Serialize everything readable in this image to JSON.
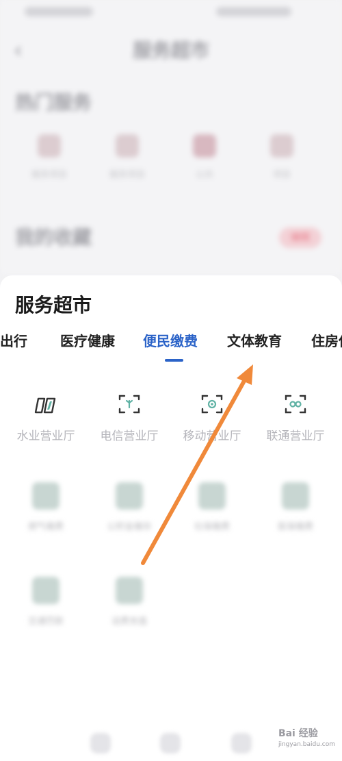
{
  "upper": {
    "title": "服务超市",
    "hot_heading": "热门服务",
    "hot_items": [
      "服务项目",
      "服务项目",
      "公共",
      "项目"
    ],
    "fav_heading": "我的收藏",
    "edit_label": "编辑"
  },
  "sheet": {
    "title": "服务超市",
    "tabs": [
      {
        "label": "交通出行"
      },
      {
        "label": "医疗健康"
      },
      {
        "label": "便民缴费"
      },
      {
        "label": "文体教育"
      },
      {
        "label": "住房保障"
      }
    ],
    "active_tab": 2,
    "service_items": [
      {
        "label": "水业营业厅",
        "icon": "water-bill-icon"
      },
      {
        "label": "电信营业厅",
        "icon": "telecom-icon"
      },
      {
        "label": "移动营业厅",
        "icon": "mobile-icon"
      },
      {
        "label": "联通营业厅",
        "icon": "unicom-icon"
      }
    ],
    "blurred_items": [
      "燃气缴费",
      "公积金缴存",
      "社保缴费",
      "医保缴费",
      "交通罚款",
      "话费充值"
    ]
  },
  "colors": {
    "accent": "#2b63c8",
    "icon_teal": "#5fb2a4",
    "arrow": "#f0893a",
    "edit_badge": "#f3d1d6"
  },
  "watermark": {
    "brand": "Bai 经验",
    "url": "jingyan.baidu.com"
  }
}
